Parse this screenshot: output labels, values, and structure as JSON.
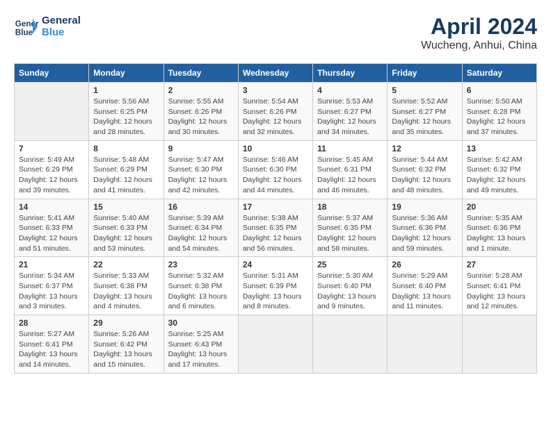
{
  "header": {
    "logo_line1": "General",
    "logo_line2": "Blue",
    "month_title": "April 2024",
    "location": "Wucheng, Anhui, China"
  },
  "days_of_week": [
    "Sunday",
    "Monday",
    "Tuesday",
    "Wednesday",
    "Thursday",
    "Friday",
    "Saturday"
  ],
  "weeks": [
    [
      {
        "day": "",
        "info": ""
      },
      {
        "day": "1",
        "info": "Sunrise: 5:56 AM\nSunset: 6:25 PM\nDaylight: 12 hours\nand 28 minutes."
      },
      {
        "day": "2",
        "info": "Sunrise: 5:55 AM\nSunset: 6:26 PM\nDaylight: 12 hours\nand 30 minutes."
      },
      {
        "day": "3",
        "info": "Sunrise: 5:54 AM\nSunset: 6:26 PM\nDaylight: 12 hours\nand 32 minutes."
      },
      {
        "day": "4",
        "info": "Sunrise: 5:53 AM\nSunset: 6:27 PM\nDaylight: 12 hours\nand 34 minutes."
      },
      {
        "day": "5",
        "info": "Sunrise: 5:52 AM\nSunset: 6:27 PM\nDaylight: 12 hours\nand 35 minutes."
      },
      {
        "day": "6",
        "info": "Sunrise: 5:50 AM\nSunset: 6:28 PM\nDaylight: 12 hours\nand 37 minutes."
      }
    ],
    [
      {
        "day": "7",
        "info": "Sunrise: 5:49 AM\nSunset: 6:29 PM\nDaylight: 12 hours\nand 39 minutes."
      },
      {
        "day": "8",
        "info": "Sunrise: 5:48 AM\nSunset: 6:29 PM\nDaylight: 12 hours\nand 41 minutes."
      },
      {
        "day": "9",
        "info": "Sunrise: 5:47 AM\nSunset: 6:30 PM\nDaylight: 12 hours\nand 42 minutes."
      },
      {
        "day": "10",
        "info": "Sunrise: 5:46 AM\nSunset: 6:30 PM\nDaylight: 12 hours\nand 44 minutes."
      },
      {
        "day": "11",
        "info": "Sunrise: 5:45 AM\nSunset: 6:31 PM\nDaylight: 12 hours\nand 46 minutes."
      },
      {
        "day": "12",
        "info": "Sunrise: 5:44 AM\nSunset: 6:32 PM\nDaylight: 12 hours\nand 48 minutes."
      },
      {
        "day": "13",
        "info": "Sunrise: 5:42 AM\nSunset: 6:32 PM\nDaylight: 12 hours\nand 49 minutes."
      }
    ],
    [
      {
        "day": "14",
        "info": "Sunrise: 5:41 AM\nSunset: 6:33 PM\nDaylight: 12 hours\nand 51 minutes."
      },
      {
        "day": "15",
        "info": "Sunrise: 5:40 AM\nSunset: 6:33 PM\nDaylight: 12 hours\nand 53 minutes."
      },
      {
        "day": "16",
        "info": "Sunrise: 5:39 AM\nSunset: 6:34 PM\nDaylight: 12 hours\nand 54 minutes."
      },
      {
        "day": "17",
        "info": "Sunrise: 5:38 AM\nSunset: 6:35 PM\nDaylight: 12 hours\nand 56 minutes."
      },
      {
        "day": "18",
        "info": "Sunrise: 5:37 AM\nSunset: 6:35 PM\nDaylight: 12 hours\nand 58 minutes."
      },
      {
        "day": "19",
        "info": "Sunrise: 5:36 AM\nSunset: 6:36 PM\nDaylight: 12 hours\nand 59 minutes."
      },
      {
        "day": "20",
        "info": "Sunrise: 5:35 AM\nSunset: 6:36 PM\nDaylight: 13 hours\nand 1 minute."
      }
    ],
    [
      {
        "day": "21",
        "info": "Sunrise: 5:34 AM\nSunset: 6:37 PM\nDaylight: 13 hours\nand 3 minutes."
      },
      {
        "day": "22",
        "info": "Sunrise: 5:33 AM\nSunset: 6:38 PM\nDaylight: 13 hours\nand 4 minutes."
      },
      {
        "day": "23",
        "info": "Sunrise: 5:32 AM\nSunset: 6:38 PM\nDaylight: 13 hours\nand 6 minutes."
      },
      {
        "day": "24",
        "info": "Sunrise: 5:31 AM\nSunset: 6:39 PM\nDaylight: 13 hours\nand 8 minutes."
      },
      {
        "day": "25",
        "info": "Sunrise: 5:30 AM\nSunset: 6:40 PM\nDaylight: 13 hours\nand 9 minutes."
      },
      {
        "day": "26",
        "info": "Sunrise: 5:29 AM\nSunset: 6:40 PM\nDaylight: 13 hours\nand 11 minutes."
      },
      {
        "day": "27",
        "info": "Sunrise: 5:28 AM\nSunset: 6:41 PM\nDaylight: 13 hours\nand 12 minutes."
      }
    ],
    [
      {
        "day": "28",
        "info": "Sunrise: 5:27 AM\nSunset: 6:41 PM\nDaylight: 13 hours\nand 14 minutes."
      },
      {
        "day": "29",
        "info": "Sunrise: 5:26 AM\nSunset: 6:42 PM\nDaylight: 13 hours\nand 15 minutes."
      },
      {
        "day": "30",
        "info": "Sunrise: 5:25 AM\nSunset: 6:43 PM\nDaylight: 13 hours\nand 17 minutes."
      },
      {
        "day": "",
        "info": ""
      },
      {
        "day": "",
        "info": ""
      },
      {
        "day": "",
        "info": ""
      },
      {
        "day": "",
        "info": ""
      }
    ]
  ]
}
